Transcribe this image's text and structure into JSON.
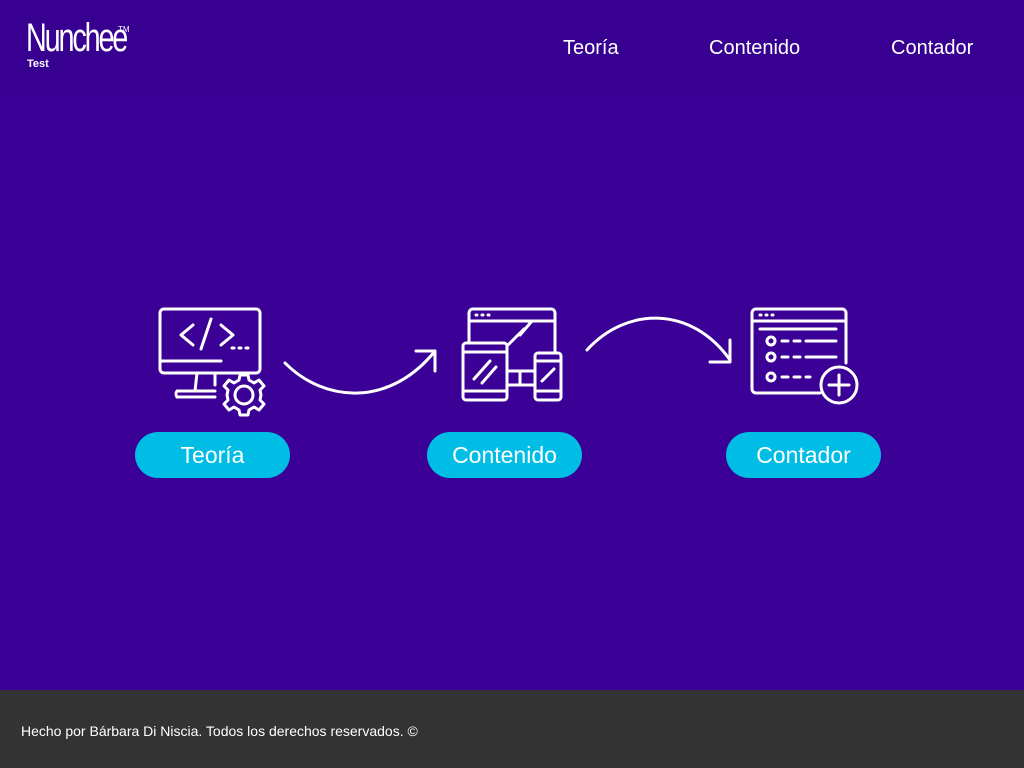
{
  "header": {
    "logo": {
      "name": "Nunchee",
      "trademark": "TM",
      "subtitle": "Test"
    },
    "nav": [
      {
        "label": "Teoría"
      },
      {
        "label": "Contenido"
      },
      {
        "label": "Contador"
      }
    ]
  },
  "steps": [
    {
      "icon": "code-monitor-gear-icon",
      "label": "Teoría"
    },
    {
      "icon": "responsive-devices-icon",
      "label": "Contenido"
    },
    {
      "icon": "list-add-icon",
      "label": "Contador"
    }
  ],
  "arrows": [
    "curved-arrow-icon",
    "curved-arrow-icon"
  ],
  "colors": {
    "background": "#3b0096",
    "header": "#370091",
    "button": "#00bde6",
    "footer": "#333333",
    "text": "#ffffff"
  },
  "footer": {
    "text": "Hecho por Bárbara Di Niscia. Todos los derechos reservados. ©"
  }
}
